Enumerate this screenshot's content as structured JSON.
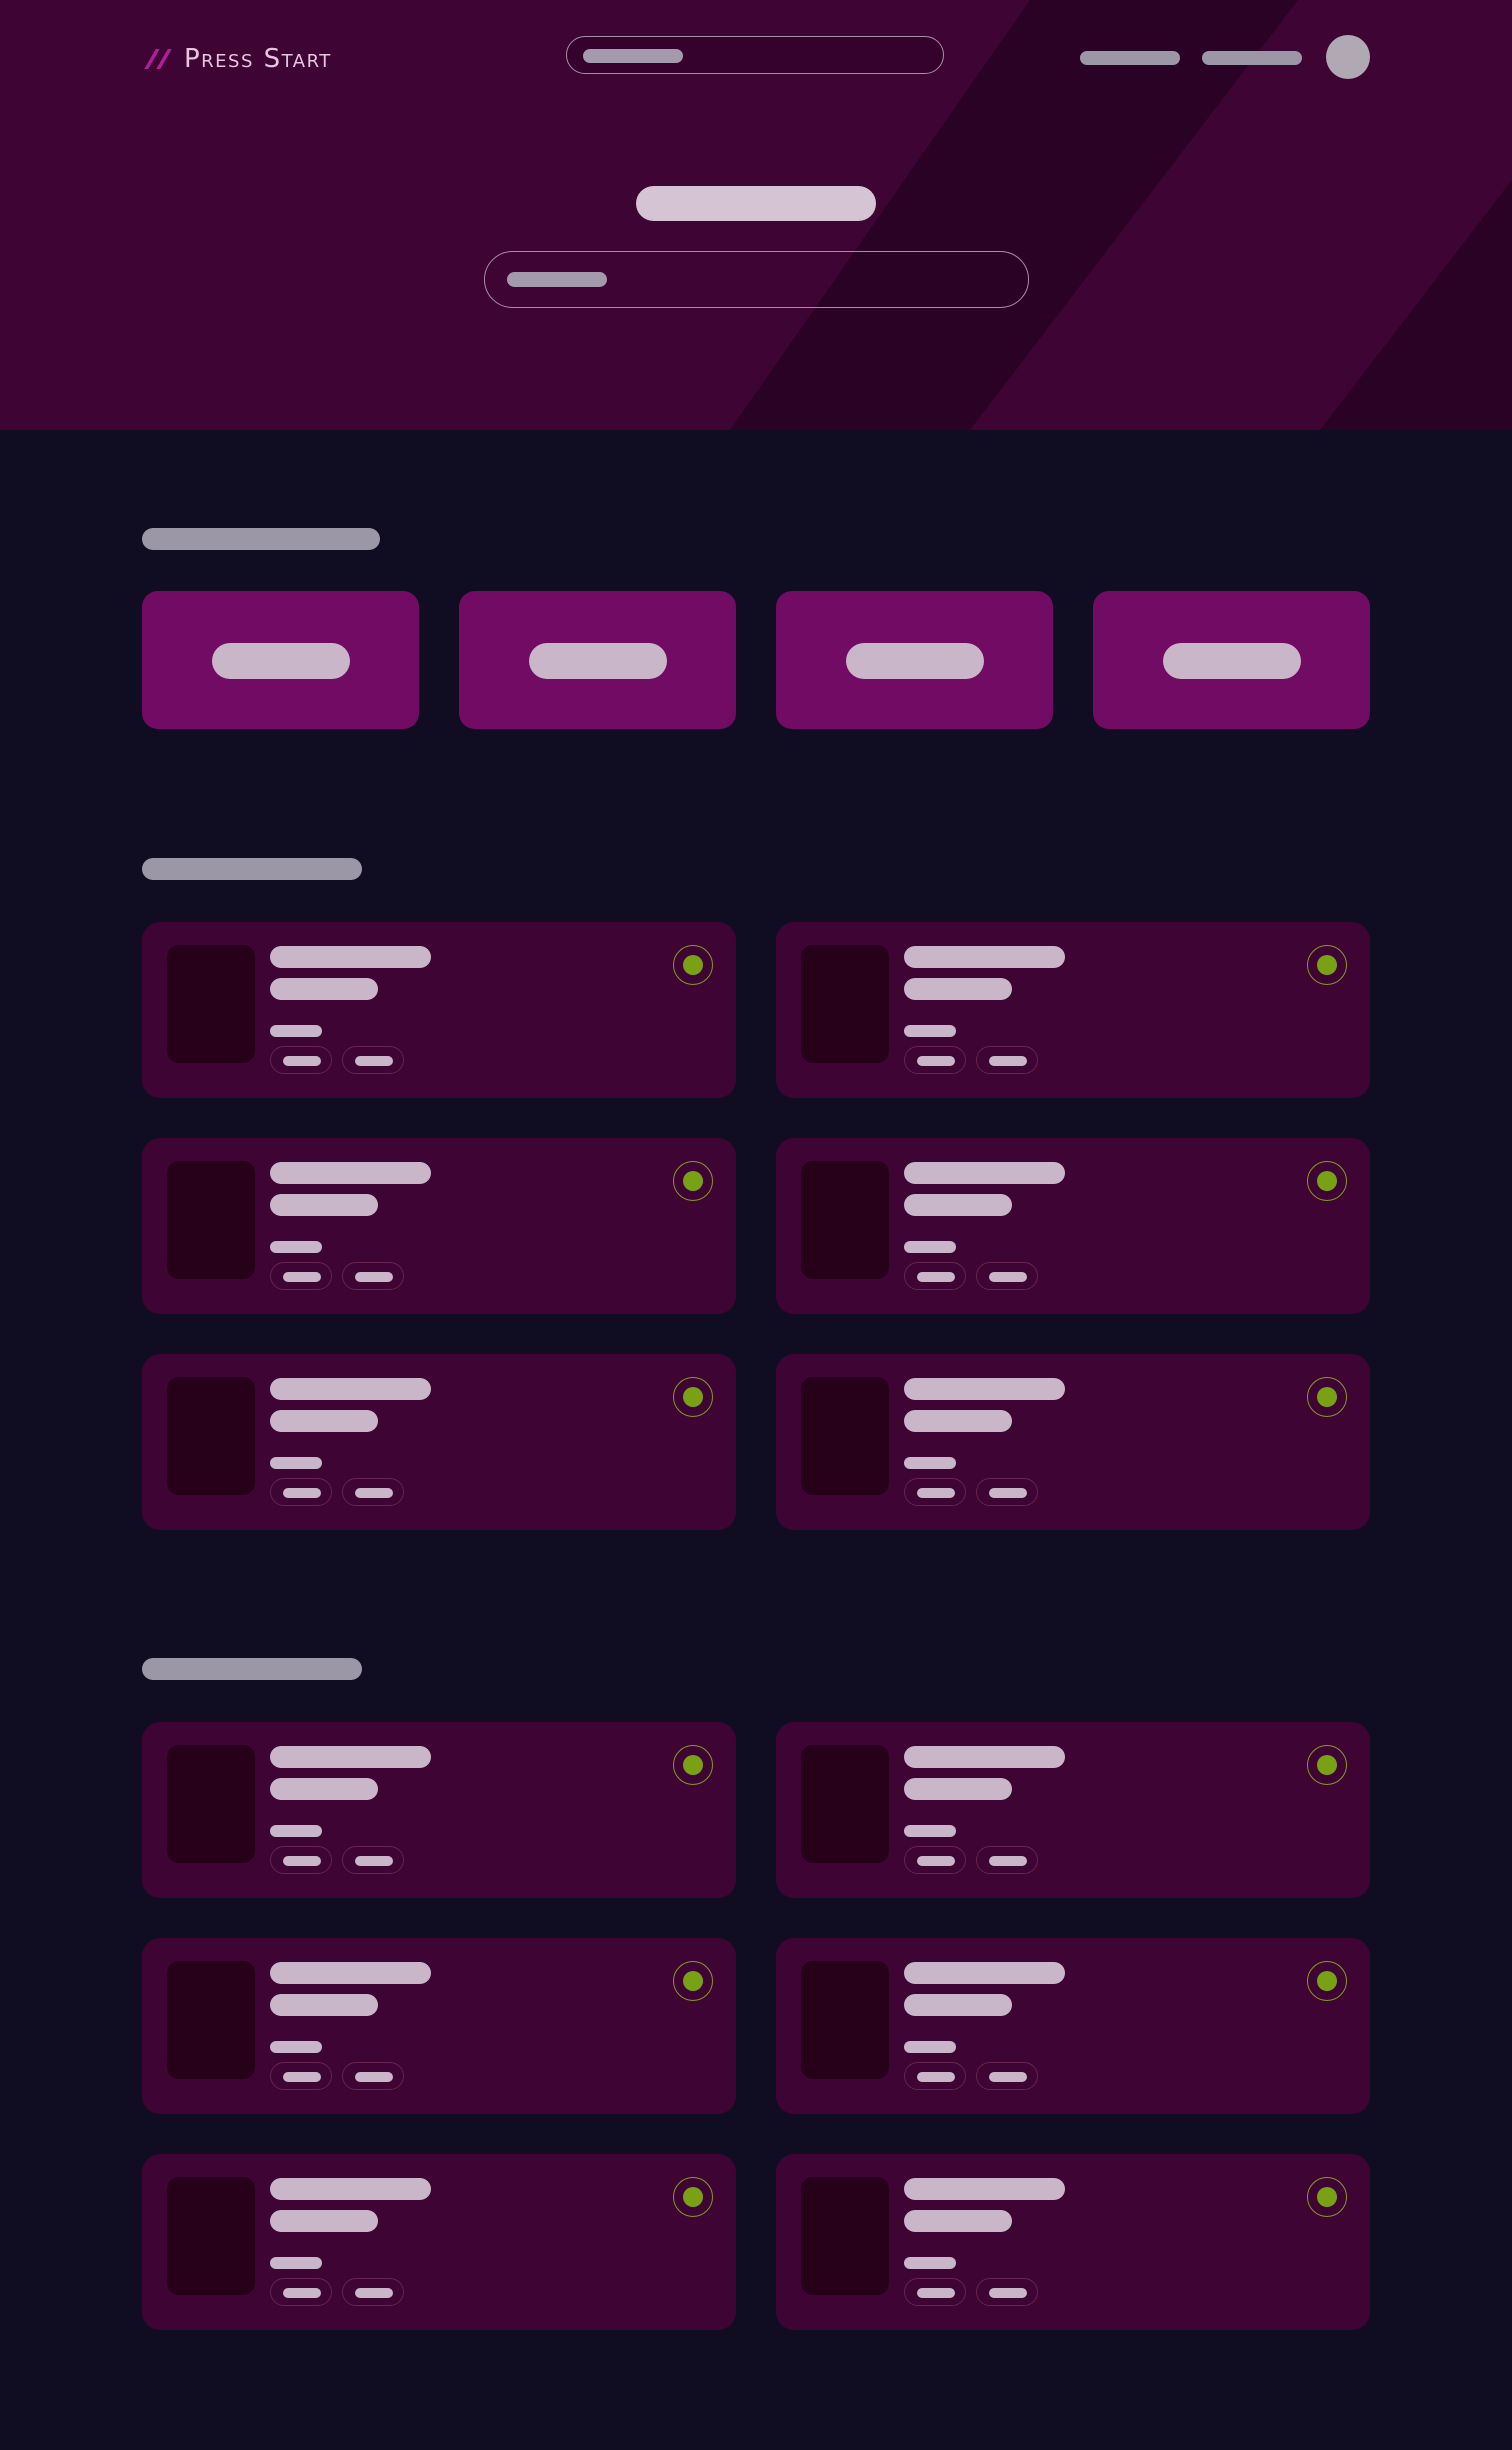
{
  "brand": {
    "name": "Press Start",
    "logo_color": "#b01e9a"
  },
  "colors": {
    "page_background": "#100d23",
    "hero_background": "#3d0434",
    "category_tile": "#720b63",
    "card_background": "#3d0434",
    "status_indicator": "#79a116"
  },
  "header": {
    "search": {
      "icon": "search-icon"
    },
    "nav_links": [
      "nav-link-1",
      "nav-link-2"
    ],
    "avatar": "user-avatar"
  },
  "hero": {
    "search": {
      "icon": "search-icon"
    }
  },
  "categories": {
    "count": 4
  },
  "sections": [
    {
      "id": "section-1",
      "card_count": 6
    },
    {
      "id": "section-2",
      "card_count": 6
    }
  ]
}
